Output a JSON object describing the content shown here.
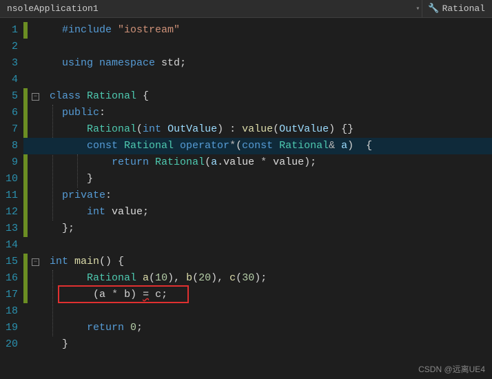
{
  "toolbar": {
    "left_tab": "nsoleApplication1",
    "right_tab": "Rational"
  },
  "gutter": [
    "1",
    "2",
    "3",
    "4",
    "5",
    "6",
    "7",
    "8",
    "9",
    "10",
    "11",
    "12",
    "13",
    "14",
    "15",
    "16",
    "17",
    "18",
    "19",
    "20"
  ],
  "code": {
    "l1": {
      "kw": "#include ",
      "str": "\"iostream\""
    },
    "l3": {
      "kw1": "using ",
      "kw2": "namespace ",
      "id": "std",
      "p": ";"
    },
    "l5": {
      "kw": "class ",
      "type": "Rational ",
      "brace": "{"
    },
    "l6": {
      "kw": "public",
      "p": ":"
    },
    "l7": {
      "type": "Rational",
      "p1": "(",
      "kw": "int ",
      "param": "OutValue",
      "p2": ") : ",
      "fn": "value",
      "p3": "(",
      "param2": "OutValue",
      "p4": ") {}"
    },
    "l8": {
      "kw1": "const ",
      "type1": "Rational ",
      "kw2": "operator",
      "op": "*",
      "p1": "(",
      "kw3": "const ",
      "type2": "Rational",
      "amp": "& ",
      "param": "a",
      "p2": ")  {"
    },
    "l9": {
      "kw": "return ",
      "type": "Rational",
      "p1": "(",
      "param": "a",
      "dot": ".",
      "field": "value ",
      "op": "* ",
      "field2": "value",
      "p2": ");"
    },
    "l10": {
      "brace": "}"
    },
    "l11": {
      "kw": "private",
      "p": ":"
    },
    "l12": {
      "kw": "int ",
      "field": "value",
      "p": ";"
    },
    "l13": {
      "brace": "};"
    },
    "l15": {
      "kw": "int ",
      "fn": "main",
      "p": "() {"
    },
    "l16": {
      "type": "Rational ",
      "v1": "a",
      "p1": "(",
      "n1": "10",
      "p2": "), ",
      "v2": "b",
      "p3": "(",
      "n2": "20",
      "p4": "), ",
      "v3": "c",
      "p5": "(",
      "n3": "30",
      "p6": ");"
    },
    "l17": {
      "p1": "(",
      "v1": "a ",
      "op1": "* ",
      "v2": "b",
      "p2": ") ",
      "eq": "=",
      "sp": " ",
      "v3": "c",
      "p3": ";"
    },
    "l19": {
      "kw": "return ",
      "n": "0",
      "p": ";"
    },
    "l20": {
      "brace": "}"
    }
  },
  "watermark": "CSDN @远离UE4"
}
